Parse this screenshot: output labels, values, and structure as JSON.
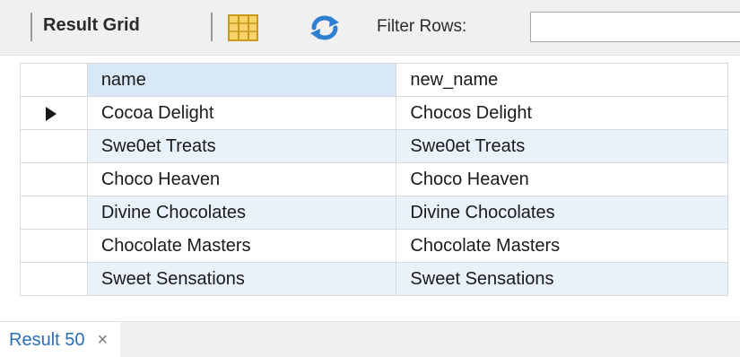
{
  "toolbar": {
    "title": "Result Grid",
    "filter_label": "Filter Rows:",
    "filter_value": "",
    "icons": [
      "grid-layout-icon",
      "refresh-icon"
    ]
  },
  "grid": {
    "columns": [
      "name",
      "new_name"
    ],
    "selected_row": 0,
    "rows": [
      {
        "name": "Cocoa Delight",
        "new_name": "Chocos Delight"
      },
      {
        "name": "Swe0et Treats",
        "new_name": "Swe0et Treats"
      },
      {
        "name": "Choco Heaven",
        "new_name": "Choco Heaven"
      },
      {
        "name": "Divine Chocolates",
        "new_name": "Divine Chocolates"
      },
      {
        "name": "Chocolate Masters",
        "new_name": "Chocolate Masters"
      },
      {
        "name": "Sweet Sensations",
        "new_name": "Sweet Sensations"
      }
    ]
  },
  "tabs": [
    {
      "label": "Result 50",
      "close": "×"
    }
  ],
  "colors": {
    "header_selected": "#d8e8f7",
    "row_alt": "#e9f1fb",
    "tab_text": "#2a6fb5"
  }
}
